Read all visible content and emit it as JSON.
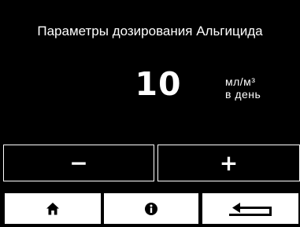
{
  "screen": {
    "title": "Параметры дозирования Альгицида",
    "value": "10",
    "unit_line1": "мл/м³",
    "unit_line2": "в день"
  },
  "controls": {
    "minus_label": "−",
    "plus_label": "+"
  },
  "nav": {
    "home_icon": "home-icon",
    "info_icon": "info-icon",
    "back_icon": "return-arrow-icon"
  },
  "colors": {
    "background": "#000000",
    "foreground": "#ffffff"
  }
}
